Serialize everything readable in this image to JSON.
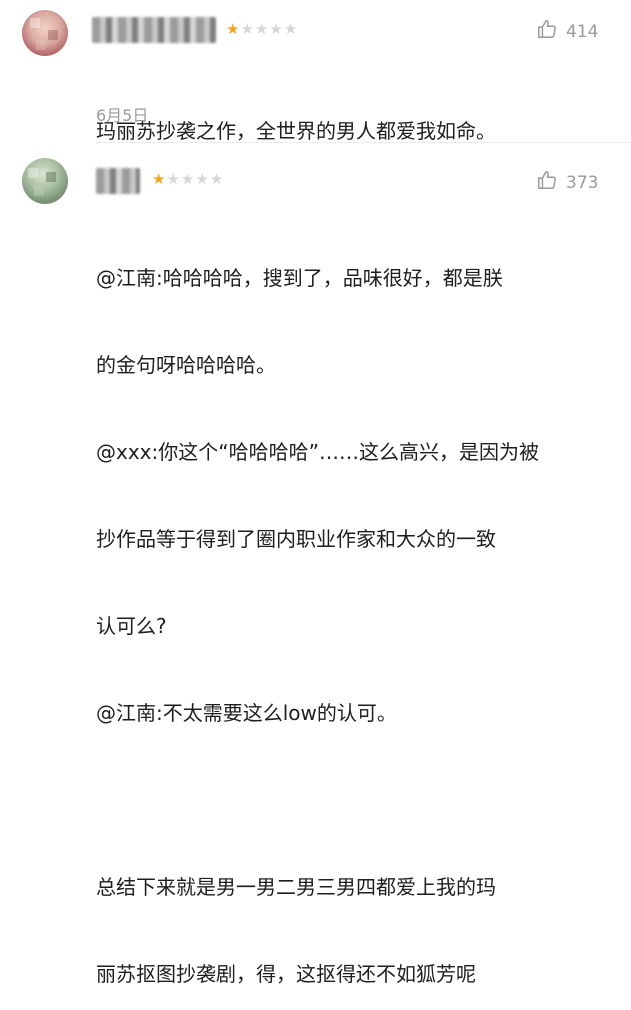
{
  "comments": [
    {
      "rating": 1,
      "max_rating": 5,
      "like_icon": "thumbs-up-icon",
      "likes": "414",
      "lines": [
        "玛丽苏抄袭之作，全世界的男人都爱我如命。"
      ],
      "date": "6月5日"
    },
    {
      "rating": 1,
      "max_rating": 5,
      "like_icon": "thumbs-up-icon",
      "likes": "373",
      "lines": [
        "@江南:哈哈哈哈，搜到了，品味很好，都是朕",
        "的金句呀哈哈哈哈。",
        "@xxx:你这个“哈哈哈哈”……这么高兴，是因为被",
        "抄作品等于得到了圈内职业作家和大众的一致",
        "认可么?",
        "@江南:不太需要这么low的认可。",
        "",
        "总结下来就是男一男二男三男四都爱上我的玛",
        "丽苏抠图抄袭剧，得，这抠得还不如狐芳呢"
      ]
    }
  ],
  "colors": {
    "star_on": "#f4a520",
    "star_off": "#d6d6d6",
    "meta_gray": "#9a9a9a"
  }
}
